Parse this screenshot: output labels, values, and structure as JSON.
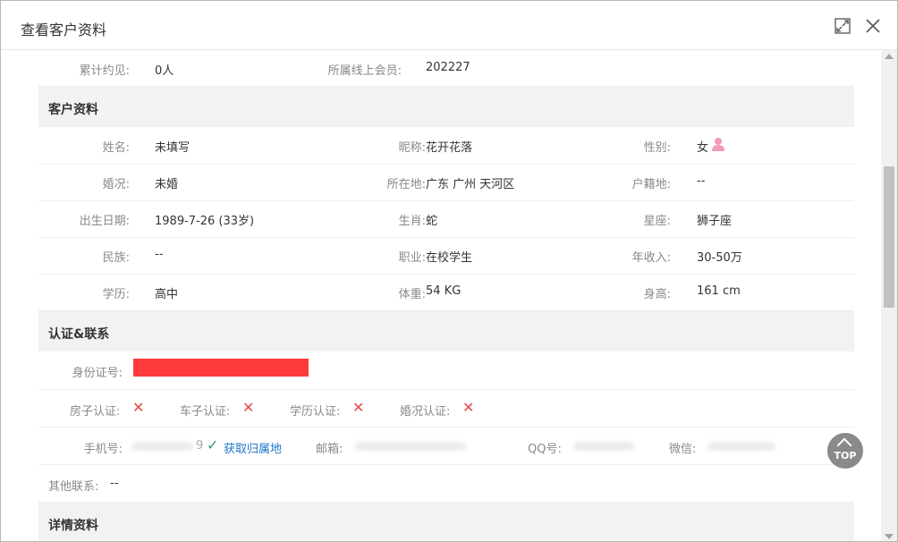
{
  "dialog": {
    "title": "查看客户资料"
  },
  "top_row": {
    "label1": "累计约见:",
    "value1": "0人",
    "label2": "所属线上会员:",
    "value2": "202227"
  },
  "profile": {
    "section_title": "客户资料",
    "rows": [
      [
        {
          "label": "姓名:",
          "value": "未填写"
        },
        {
          "label": "昵称:",
          "value": "花开花落"
        },
        {
          "label": "性别:",
          "value": "女"
        }
      ],
      [
        {
          "label": "婚况:",
          "value": "未婚"
        },
        {
          "label": "所在地:",
          "value": "广东 广州 天河区"
        },
        {
          "label": "户籍地:",
          "value": "--"
        }
      ],
      [
        {
          "label": "出生日期:",
          "value": "1989-7-26 (33岁)"
        },
        {
          "label": "生肖:",
          "value": "蛇"
        },
        {
          "label": "星座:",
          "value": "狮子座"
        }
      ],
      [
        {
          "label": "民族:",
          "value": "--"
        },
        {
          "label": "职业:",
          "value": "在校学生"
        },
        {
          "label": "年收入:",
          "value": "30-50万"
        }
      ],
      [
        {
          "label": "学历:",
          "value": "高中"
        },
        {
          "label": "体重:",
          "value": "54 KG"
        },
        {
          "label": "身高:",
          "value": "161 cm"
        }
      ]
    ]
  },
  "contact": {
    "section_title": "认证&联系",
    "id_label": "身份证号:",
    "certs": [
      {
        "label": "房子认证:",
        "mark": "✕"
      },
      {
        "label": "车子认证:",
        "mark": "✕"
      },
      {
        "label": "学历认证:",
        "mark": "✕"
      },
      {
        "label": "婚况认证:",
        "mark": "✕"
      }
    ],
    "phone_label": "手机号:",
    "phone_partial": "9",
    "check_mark": "✓",
    "get_location": "获取归属地",
    "email_label": "邮箱:",
    "qq_label": "QQ号:",
    "wechat_label": "微信:",
    "other_label": "其他联系:",
    "other_value": "--"
  },
  "details": {
    "section_title": "详情资料"
  },
  "top_button": {
    "label": "TOP"
  },
  "colors": {
    "cross": "#e84848",
    "link": "#1e78c8",
    "female_icon": "#f29ab5",
    "redaction": "#ff3a3a"
  }
}
